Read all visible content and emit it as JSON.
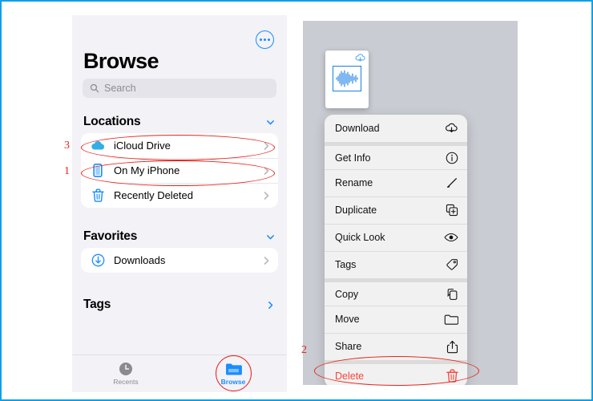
{
  "frame": {
    "border_color": "#0f9fe8",
    "background": "#ffffff"
  },
  "left_phone": {
    "more_button": {
      "icon": "ellipsis-circle-icon",
      "color": "#1a8cff"
    },
    "title": "Browse",
    "search": {
      "placeholder": "Search",
      "icon": "search-icon"
    },
    "sections": [
      {
        "header": "Locations",
        "chevron": "chevron-down-icon",
        "items": [
          {
            "label": "iCloud Drive",
            "icon": "icloud-icon",
            "chevron": "chevron-right-icon",
            "annotation": "3",
            "highlighted": true
          },
          {
            "label": "On My iPhone",
            "icon": "iphone-icon",
            "chevron": "chevron-right-icon",
            "annotation": "1",
            "highlighted": true
          },
          {
            "label": "Recently Deleted",
            "icon": "trash-icon",
            "chevron": "chevron-right-icon",
            "annotation": "",
            "highlighted": false
          }
        ]
      },
      {
        "header": "Favorites",
        "chevron": "chevron-down-icon",
        "items": [
          {
            "label": "Downloads",
            "icon": "download-circle-icon",
            "chevron": "chevron-right-icon",
            "annotation": "",
            "highlighted": false
          }
        ]
      },
      {
        "header": "Tags",
        "chevron": "chevron-right-icon",
        "items": []
      }
    ],
    "tabbar": [
      {
        "label": "Recents",
        "icon": "clock-icon",
        "active": false
      },
      {
        "label": "Browse",
        "icon": "folder-icon",
        "active": true,
        "highlighted": true
      }
    ]
  },
  "right_phone": {
    "file_thumbnail": {
      "icon": "audio-waveform-icon",
      "badge": "cloud-download-icon"
    },
    "context_menu": [
      {
        "label": "Download",
        "icon": "cloud-download-icon",
        "group": 0,
        "danger": false
      },
      {
        "label": "Get Info",
        "icon": "info-circle-icon",
        "group": 1,
        "danger": false
      },
      {
        "label": "Rename",
        "icon": "pencil-icon",
        "group": 1,
        "danger": false
      },
      {
        "label": "Duplicate",
        "icon": "duplicate-icon",
        "group": 1,
        "danger": false
      },
      {
        "label": "Quick Look",
        "icon": "eye-icon",
        "group": 1,
        "danger": false
      },
      {
        "label": "Tags",
        "icon": "tag-icon",
        "group": 1,
        "danger": false
      },
      {
        "label": "Copy",
        "icon": "copy-icon",
        "group": 2,
        "danger": false
      },
      {
        "label": "Move",
        "icon": "folder-icon",
        "group": 2,
        "danger": false
      },
      {
        "label": "Share",
        "icon": "share-icon",
        "group": 2,
        "danger": false
      },
      {
        "label": "Delete",
        "icon": "trash-icon",
        "group": 3,
        "danger": true,
        "annotation": "2"
      }
    ]
  },
  "annotations": {
    "color": "#e8231a",
    "numbers": [
      "3",
      "1",
      "2"
    ]
  }
}
